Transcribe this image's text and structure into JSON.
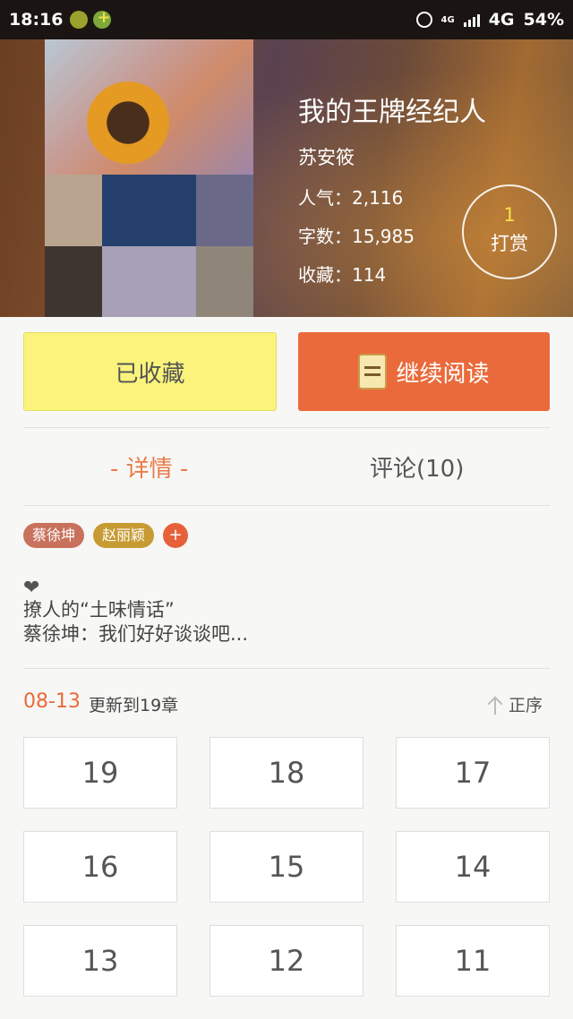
{
  "status_bar": {
    "time": "18:16",
    "network_small": "4G",
    "network": "4G",
    "battery": "54%"
  },
  "book": {
    "title": "我的王牌经纪人",
    "author": "苏安筱",
    "popularity": "人气：2,116",
    "word_count": "字数：15,985",
    "favorites": "收藏：114"
  },
  "reward": {
    "count": "1",
    "label": "打赏"
  },
  "actions": {
    "favorited_label": "已收藏",
    "continue_label": "继续阅读"
  },
  "tabs": {
    "details": "- 详情 -",
    "comments": "评论(10)"
  },
  "tags": [
    "蔡徐坤",
    "赵丽颖"
  ],
  "tag_add": "+",
  "description": {
    "icon": "❤",
    "line1": "撩人的“土味情话”",
    "line2": "蔡徐坤：我们好好谈谈吧..."
  },
  "updates": {
    "date": "08-13",
    "text": "更新到19章",
    "sort_label": "正序"
  },
  "chapters": [
    "19",
    "18",
    "17",
    "16",
    "15",
    "14",
    "13",
    "12",
    "11"
  ],
  "colors": {
    "accent": "#ea6a3b",
    "favorited_bg": "#fbf47c",
    "reward_count": "#f6e04a"
  }
}
